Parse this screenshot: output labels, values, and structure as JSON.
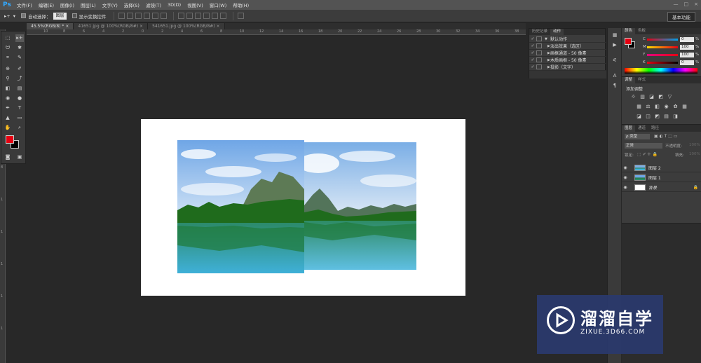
{
  "app": {
    "logo": "Ps"
  },
  "menu": [
    "文件(F)",
    "编辑(E)",
    "图像(I)",
    "图层(L)",
    "文字(Y)",
    "选择(S)",
    "滤镜(T)",
    "3D(D)",
    "视图(V)",
    "窗口(W)",
    "帮助(H)"
  ],
  "window_controls": [
    "—",
    "□",
    "×"
  ],
  "options": {
    "auto_select_label": "自动选择：",
    "auto_select_value": "图层",
    "show_transform_label": "显示变换控件",
    "workspace": "基本功能"
  },
  "tabs": [
    {
      "label": "45.5%(RGB/8) *",
      "close": "×",
      "active": true
    },
    {
      "label": "41651.jpg @ 100%(RGB/8#)",
      "close": "×",
      "active": false
    },
    {
      "label": "541651.jpg @ 100%(RGB/8#)",
      "close": "×",
      "active": false
    }
  ],
  "ruler_top": [
    "10",
    "8",
    "6",
    "4",
    "2",
    "0",
    "2",
    "4",
    "6",
    "8",
    "10",
    "12",
    "14",
    "16",
    "18",
    "20",
    "22",
    "24",
    "26",
    "28",
    "30",
    "32",
    "34",
    "36",
    "38",
    "40"
  ],
  "ruler_left": [
    "0",
    "2",
    "4",
    "6",
    "8",
    "1",
    "1",
    "1",
    "1",
    "1"
  ],
  "tools": {
    "move": "▸+",
    "marquee": "⬚",
    "lasso": "ᗢ",
    "magic_wand": "✱",
    "crop": "⌗",
    "eyedropper": "✎",
    "healing": "⊕",
    "brush": "✐",
    "stamp": "⚲",
    "history_brush": "⤴",
    "eraser": "◧",
    "gradient": "▤",
    "blur": "◉",
    "dodge": "●",
    "pen": "✒",
    "type": "T",
    "path_select": "▲",
    "shape": "▭",
    "hand": "✋",
    "zoom": "⌕",
    "quick_mask": "◙",
    "screen_mode": "▣"
  },
  "actions_panel": {
    "tabs": [
      "历史记录",
      "动作"
    ],
    "rows": [
      {
        "check": "✓",
        "tri": "▼",
        "name": "默认动作"
      },
      {
        "check": "✓",
        "tri": "▶",
        "name": "淡出效果（选区）"
      },
      {
        "check": "✓",
        "tri": "▶",
        "name": "画框通道 - 50 像素"
      },
      {
        "check": "✓",
        "tri": "▶",
        "name": "木质画框 - 50 像素"
      },
      {
        "check": "✓",
        "tri": "▶",
        "name": "投影（文字）"
      }
    ]
  },
  "color_panel": {
    "tabs": [
      "颜色",
      "色板"
    ],
    "channels": [
      {
        "label": "C",
        "value": "0",
        "unit": "%"
      },
      {
        "label": "M",
        "value": "100",
        "unit": "%"
      },
      {
        "label": "Y",
        "value": "100",
        "unit": "%"
      },
      {
        "label": "K",
        "value": "0",
        "unit": "%"
      }
    ],
    "foreground": "#e60012",
    "background": "#000000"
  },
  "adjustments_panel": {
    "tabs": [
      "调整",
      "样式"
    ],
    "title": "添加调整"
  },
  "layers_panel": {
    "tabs": [
      "图层",
      "通道",
      "路径"
    ],
    "kind_filter": "ρ 类型",
    "blend_mode": "正常",
    "opacity_label": "不透明度:",
    "opacity_value": "100%",
    "lock_label": "锁定:",
    "fill_label": "填充:",
    "fill_value": "100%",
    "layers": [
      {
        "name": "图层 2",
        "visible": true
      },
      {
        "name": "图层 1",
        "visible": true
      },
      {
        "name": "背景",
        "visible": true,
        "locked": true
      }
    ]
  },
  "watermark": {
    "title": "溜溜自学",
    "url": "ZIXUE.3D66.COM"
  }
}
